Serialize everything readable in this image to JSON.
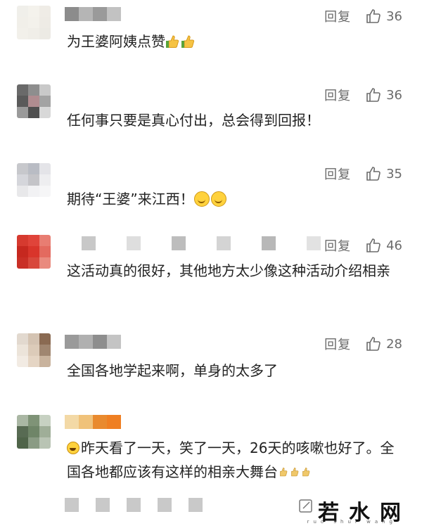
{
  "comments": [
    {
      "reply_label": "回复",
      "likes": "36",
      "text": "为王婆阿姨点赞",
      "emoji": "thumbs-up x2",
      "avatar_colors": [
        "#f0efea",
        "#f4f2ec",
        "#efece6",
        "#f1efe9",
        "#f3f1eb",
        "#eeebe5",
        "#f2f0ea",
        "#f0eee8",
        "#eceae4"
      ],
      "name_colors": [
        "#8c8c8c",
        "#b5b5b5",
        "#9a9a9a",
        "#c2c2c2"
      ]
    },
    {
      "reply_label": "回复",
      "likes": "36",
      "text": "任何事只要是真心付出，总会得到回报！",
      "avatar_colors": [
        "#6a6a6a",
        "#8e8e8e",
        "#c9c9c9",
        "#5a5a5a",
        "#b08c90",
        "#a3a3a3",
        "#9a9a9a",
        "#4f4f4f",
        "#d8d8d8"
      ],
      "name_colors": []
    },
    {
      "reply_label": "回复",
      "likes": "35",
      "text": "期待“王婆”来江西！",
      "emoji": "smile x2",
      "avatar_colors": [
        "#c7c8cc",
        "#b9bcc4",
        "#e4e4e8",
        "#d5d6db",
        "#c4c4c8",
        "#eeeef0",
        "#e8e8ea",
        "#f2f2f4",
        "#f6f6f7"
      ],
      "name_colors": []
    },
    {
      "reply_label": "回复",
      "likes": "46",
      "text": "这活动真的很好，其他地方太少像这种活动介绍相亲",
      "avatar_colors": [
        "#d63a2f",
        "#e0443a",
        "#e87d72",
        "#c6281f",
        "#d9352b",
        "#e36a5f",
        "#c92f26",
        "#d8483c",
        "#e98a7e"
      ],
      "name_colors": [
        "#c8c8c8",
        "#dedede",
        "#bdbdbd",
        "#d4d4d4",
        "#b8b8b8",
        "#e2e2e2"
      ]
    },
    {
      "reply_label": "回复",
      "likes": "28",
      "text": "全国各地学起来啊，单身的太多了",
      "avatar_colors": [
        "#e2d9cf",
        "#d4c3b2",
        "#8a6a52",
        "#ece4da",
        "#dccbb9",
        "#a08670",
        "#f2ebe3",
        "#e5d5c4",
        "#c9b39d"
      ],
      "name_colors": [
        "#9a9a9a",
        "#b0b0b0",
        "#8e8e8e",
        "#c4c4c4"
      ]
    },
    {
      "reply_label": "",
      "likes": "",
      "text": "昨天看了一天，笑了一天，26天的咳嗽也好了。全国各地都应该有这样的相亲大舞台",
      "emoji_prefix": "laugh",
      "emoji_suffix": "thumbs-up x3",
      "avatar_colors": [
        "#aab7a4",
        "#7f9377",
        "#c7d1c2",
        "#586b53",
        "#6f8568",
        "#9fae98",
        "#4f6449",
        "#8a9b84",
        "#b9c4b4"
      ],
      "name_colors": [
        "#f3d9a6",
        "#f0c27a",
        "#e98a2e",
        "#ef7f22"
      ]
    }
  ],
  "bottom": {
    "watermark": "若水网",
    "watermark_sub": "ruo shui wang"
  },
  "colors": {
    "action_gray": "#6b6b6b",
    "text": "#222222",
    "emoji_yellow": "#ffd23d"
  }
}
